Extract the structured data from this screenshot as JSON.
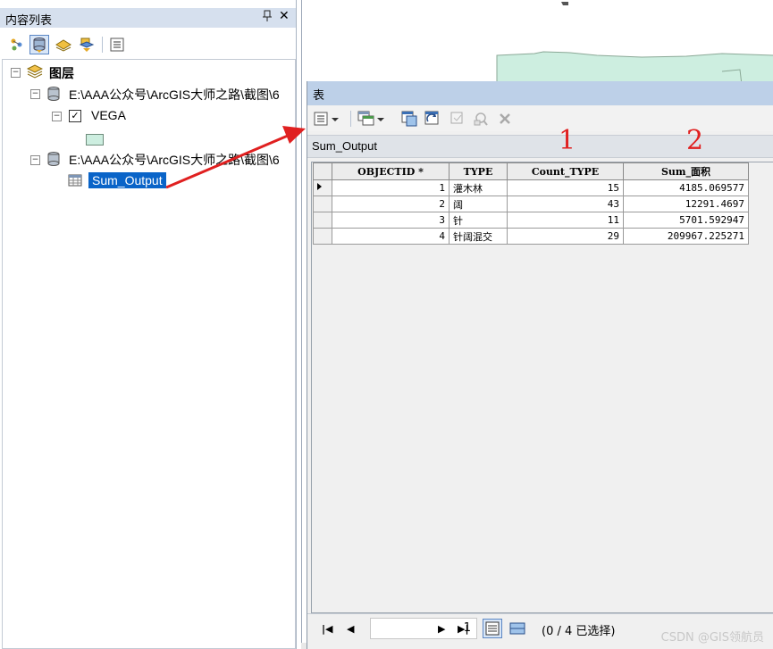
{
  "toc": {
    "title": "内容列表",
    "pin_icon": "pin-icon",
    "close_glyph": "✕",
    "tree": {
      "root_label": "图层",
      "items": [
        {
          "label": "E:\\AAA公众号\\ArcGIS大师之路\\截图\\6"
        },
        {
          "label": "VEGA"
        },
        {
          "label": "E:\\AAA公众号\\ArcGIS大师之路\\截图\\6"
        },
        {
          "label": "Sum_Output"
        }
      ],
      "swatch_color": "#cdeee0"
    }
  },
  "table_window": {
    "title": "表",
    "table_name": "Sum_Output",
    "columns": [
      "OBJECTID *",
      "TYPE",
      "Count_TYPE",
      "Sum_面积"
    ],
    "rows": [
      {
        "objectid": "1",
        "type": "灌木林",
        "count": "15",
        "sum": "4185.069577"
      },
      {
        "objectid": "2",
        "type": "阔",
        "count": "43",
        "sum": "12291.4697"
      },
      {
        "objectid": "3",
        "type": "针",
        "count": "11",
        "sum": "5701.592947"
      },
      {
        "objectid": "4",
        "type": "针阔混交",
        "count": "29",
        "sum": "209967.225271"
      }
    ],
    "record_value": "1",
    "selection_text": "(0 / 4 已选择)"
  },
  "annotations": {
    "marker_1": "1",
    "marker_2": "2",
    "arrow_color": "#e02020"
  },
  "watermark": "CSDN @GIS领航员",
  "colors": {
    "selection": "#0a64c8",
    "title_bar": "#bdd0e8",
    "map_polygon": "#cdeee0"
  }
}
